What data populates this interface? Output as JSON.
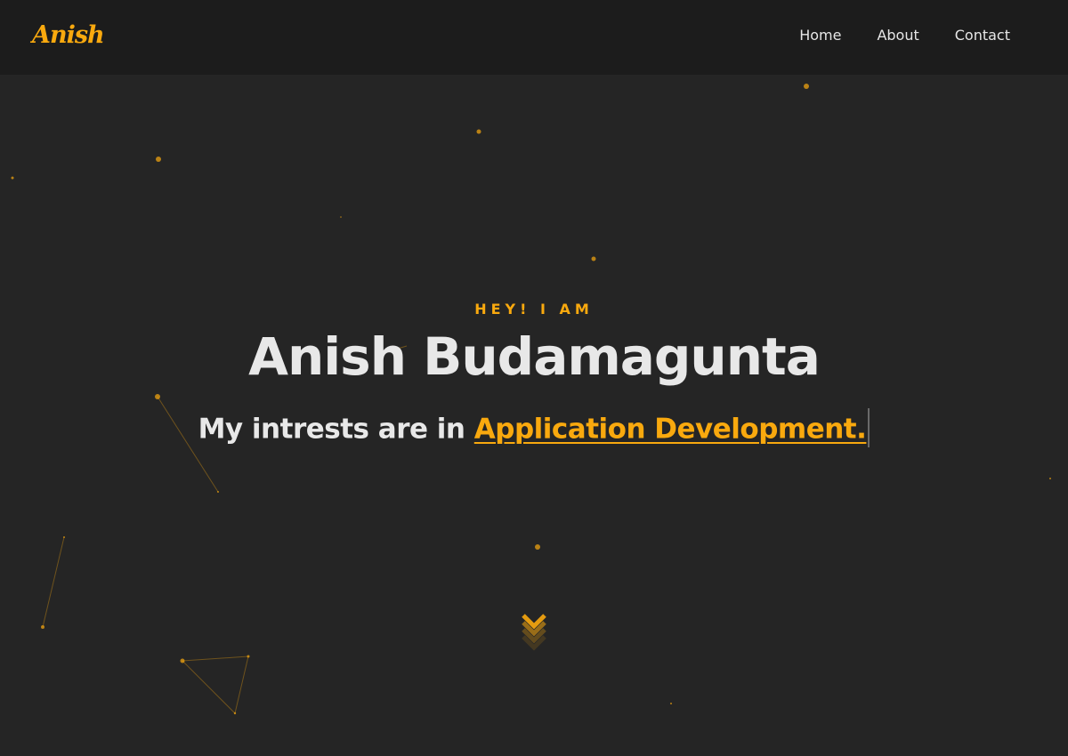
{
  "navbar": {
    "logo": "Anish",
    "links": [
      "Home",
      "About",
      "Contact"
    ]
  },
  "hero": {
    "greeting": "HEY! I AM",
    "name": "Anish Budamagunta",
    "interests_prefix": "My intrests are in ",
    "interests_highlight": "Application Development."
  },
  "icons": {
    "scroll": "chevron-down-icon"
  },
  "colors": {
    "accent": "#f9a90e",
    "background": "#252525",
    "navbar": "#1c1c1c",
    "text": "#e8e8e8"
  }
}
